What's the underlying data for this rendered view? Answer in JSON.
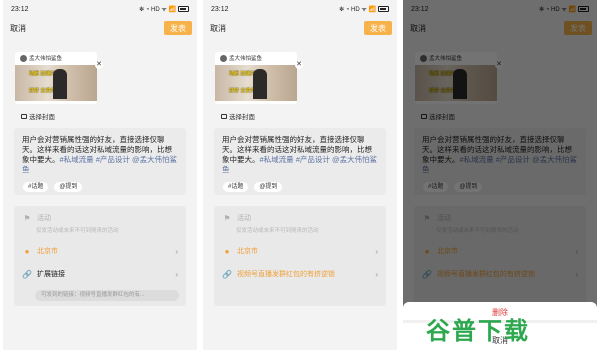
{
  "status": {
    "time": "23:12",
    "icons": "✻ ◔ HD ᯤ 📶"
  },
  "topbar": {
    "cancel": "取消",
    "publish": "发表"
  },
  "cover": {
    "account": "孟大伟怕鲨鱼",
    "overlay_text_1": "动起 加速兴",
    "overlay_text_2": "好好 主讲先"
  },
  "choose_cover": "选择封面",
  "post": {
    "text_plain": "用户会对营销属性强的好友，直接选择仅聊天。这样来看的话这对私域流量的影响，比想象中要大。",
    "hashtags": "#私域流量 #产品设计 @孟大伟怕鲨鱼",
    "chips": [
      "#话题",
      "@提到"
    ]
  },
  "options": {
    "activity": "活动",
    "activity_hint": "仅发活动或未来不可到随来的活动",
    "location": "北京市",
    "link_1": "扩展链接",
    "link_hint": "可发到的链接：视频号直播发群红包的有...",
    "link_2": "视频号直播发群红包的有挤逆锁"
  },
  "sheet": {
    "delete": "删除",
    "cancel": "取消"
  },
  "watermark": "谷普下载",
  "colors": {
    "accent": "#f7b24a",
    "hashtag": "#5e74a3",
    "delete": "#e03b3b",
    "watermark": "#2ea84f"
  }
}
